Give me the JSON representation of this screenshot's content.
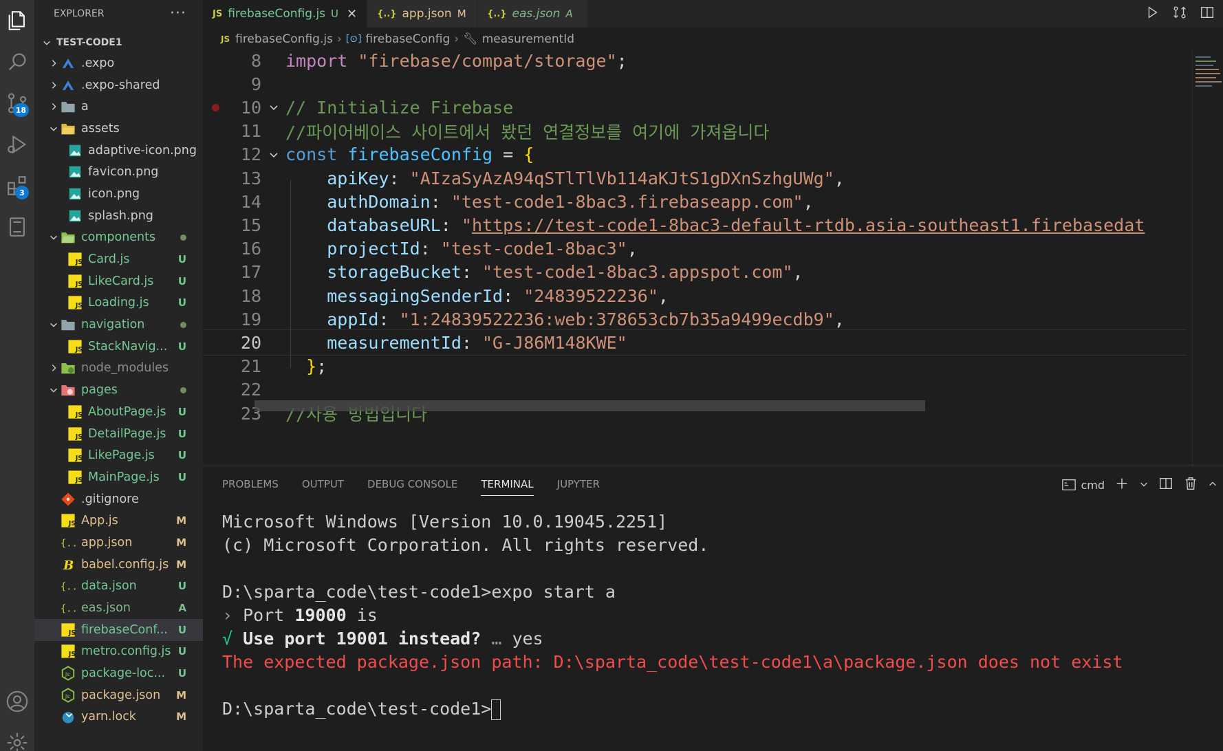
{
  "activity_bar": {
    "items": [
      {
        "name": "explorer"
      },
      {
        "name": "search"
      },
      {
        "name": "source-control",
        "badge": "18"
      },
      {
        "name": "run-debug"
      },
      {
        "name": "extensions",
        "badge": "3"
      },
      {
        "name": "remote-explorer"
      },
      {
        "name": "accounts"
      },
      {
        "name": "manage"
      }
    ]
  },
  "sidebar": {
    "title": "EXPLORER",
    "more": "···",
    "root": "TEST-CODE1",
    "tree": [
      {
        "label": ".expo",
        "depth": 0,
        "type": "folder",
        "expanded": false,
        "icon": "expo",
        "status": ""
      },
      {
        "label": ".expo-shared",
        "depth": 0,
        "type": "folder",
        "expanded": false,
        "icon": "expo",
        "status": ""
      },
      {
        "label": "a",
        "depth": 0,
        "type": "folder",
        "expanded": false,
        "icon": "folder",
        "status": ""
      },
      {
        "label": "assets",
        "depth": 0,
        "type": "folder",
        "expanded": true,
        "icon": "folder-yellow",
        "status": ""
      },
      {
        "label": "adaptive-icon.png",
        "depth": 1,
        "type": "file",
        "icon": "image",
        "status": ""
      },
      {
        "label": "favicon.png",
        "depth": 1,
        "type": "file",
        "icon": "image",
        "status": ""
      },
      {
        "label": "icon.png",
        "depth": 1,
        "type": "file",
        "icon": "image",
        "status": ""
      },
      {
        "label": "splash.png",
        "depth": 1,
        "type": "file",
        "icon": "image",
        "status": ""
      },
      {
        "label": "components",
        "depth": 0,
        "type": "folder",
        "expanded": true,
        "icon": "folder-green",
        "status": "dot",
        "color": "untracked"
      },
      {
        "label": "Card.js",
        "depth": 1,
        "type": "file",
        "icon": "js",
        "status": "U",
        "color": "untracked"
      },
      {
        "label": "LikeCard.js",
        "depth": 1,
        "type": "file",
        "icon": "js",
        "status": "U",
        "color": "untracked"
      },
      {
        "label": "Loading.js",
        "depth": 1,
        "type": "file",
        "icon": "js",
        "status": "U",
        "color": "untracked"
      },
      {
        "label": "navigation",
        "depth": 0,
        "type": "folder",
        "expanded": true,
        "icon": "folder",
        "status": "dot",
        "color": "untracked"
      },
      {
        "label": "StackNavig...",
        "depth": 1,
        "type": "file",
        "icon": "js",
        "status": "U",
        "color": "untracked"
      },
      {
        "label": "node_modules",
        "depth": 0,
        "type": "folder",
        "expanded": false,
        "icon": "folder-node",
        "status": "",
        "color": "ignored"
      },
      {
        "label": "pages",
        "depth": 0,
        "type": "folder",
        "expanded": true,
        "icon": "folder-red",
        "status": "dot",
        "color": "untracked"
      },
      {
        "label": "AboutPage.js",
        "depth": 1,
        "type": "file",
        "icon": "js",
        "status": "U",
        "color": "untracked"
      },
      {
        "label": "DetailPage.js",
        "depth": 1,
        "type": "file",
        "icon": "js",
        "status": "U",
        "color": "untracked"
      },
      {
        "label": "LikePage.js",
        "depth": 1,
        "type": "file",
        "icon": "js",
        "status": "U",
        "color": "untracked"
      },
      {
        "label": "MainPage.js",
        "depth": 1,
        "type": "file",
        "icon": "js",
        "status": "U",
        "color": "untracked"
      },
      {
        "label": ".gitignore",
        "depth": 0,
        "type": "file",
        "icon": "git",
        "status": ""
      },
      {
        "label": "App.js",
        "depth": 0,
        "type": "file",
        "icon": "js",
        "status": "M",
        "color": "mod"
      },
      {
        "label": "app.json",
        "depth": 0,
        "type": "file",
        "icon": "json",
        "status": "M",
        "color": "mod"
      },
      {
        "label": "babel.config.js",
        "depth": 0,
        "type": "file",
        "icon": "babel",
        "status": "M",
        "color": "mod"
      },
      {
        "label": "data.json",
        "depth": 0,
        "type": "file",
        "icon": "json",
        "status": "U",
        "color": "untracked"
      },
      {
        "label": "eas.json",
        "depth": 0,
        "type": "file",
        "icon": "json",
        "status": "A",
        "color": "added"
      },
      {
        "label": "firebaseConf...",
        "depth": 0,
        "type": "file",
        "icon": "js",
        "status": "U",
        "color": "untracked",
        "selected": true
      },
      {
        "label": "metro.config.js",
        "depth": 0,
        "type": "file",
        "icon": "js",
        "status": "U",
        "color": "untracked"
      },
      {
        "label": "package-loc...",
        "depth": 0,
        "type": "file",
        "icon": "node",
        "status": "U",
        "color": "untracked"
      },
      {
        "label": "package.json",
        "depth": 0,
        "type": "file",
        "icon": "node",
        "status": "M",
        "color": "mod"
      },
      {
        "label": "yarn.lock",
        "depth": 0,
        "type": "file",
        "icon": "yarn",
        "status": "M",
        "color": "mod"
      }
    ]
  },
  "tabs": [
    {
      "label": "firebaseConfig.js",
      "icon": "JS",
      "status": "U",
      "active": true,
      "close": "✕",
      "color": "untracked"
    },
    {
      "label": "app.json",
      "icon": "{..}",
      "status": "M",
      "active": false,
      "color": "mod"
    },
    {
      "label": "eas.json",
      "icon": "{..}",
      "status": "A",
      "active": false,
      "color": "added",
      "italic": true
    }
  ],
  "breadcrumb": {
    "file": "firebaseConfig.js",
    "symbol": "firebaseConfig",
    "property": "measurementId"
  },
  "code": {
    "current_line": 20,
    "breakpoint_line": 10,
    "lines": [
      {
        "n": "8",
        "tokens": [
          [
            "kw2",
            "import "
          ],
          [
            "str",
            "\"firebase/compat/storage\""
          ],
          [
            "punct",
            ";"
          ]
        ]
      },
      {
        "n": "9",
        "tokens": []
      },
      {
        "n": "10",
        "fold": true,
        "tokens": [
          [
            "cmt",
            "// Initialize Firebase"
          ]
        ]
      },
      {
        "n": "11",
        "tokens": [
          [
            "cmt",
            "//파이어베이스 사이트에서 봤던 연결정보를 여기에 가져옵니다"
          ]
        ]
      },
      {
        "n": "12",
        "fold": true,
        "tokens": [
          [
            "kw",
            "const "
          ],
          [
            "var",
            "firebaseConfig"
          ],
          [
            "punct",
            " = "
          ],
          [
            "brace",
            "{"
          ]
        ]
      },
      {
        "n": "13",
        "tokens": [
          [
            "punct",
            "    "
          ],
          [
            "prop",
            "apiKey"
          ],
          [
            "punct",
            ": "
          ],
          [
            "str",
            "\"AIzaSyAzA94qSTlTlVb114aKJtS1gDXnSzhgUWg\""
          ],
          [
            "punct",
            ","
          ]
        ]
      },
      {
        "n": "14",
        "tokens": [
          [
            "punct",
            "    "
          ],
          [
            "prop",
            "authDomain"
          ],
          [
            "punct",
            ": "
          ],
          [
            "str",
            "\"test-code1-8bac3.firebaseapp.com\""
          ],
          [
            "punct",
            ","
          ]
        ]
      },
      {
        "n": "15",
        "tokens": [
          [
            "punct",
            "    "
          ],
          [
            "prop",
            "databaseURL"
          ],
          [
            "punct",
            ": "
          ],
          [
            "str",
            "\""
          ],
          [
            "str url",
            "https://test-code1-8bac3-default-rtdb.asia-southeast1.firebasedat"
          ]
        ]
      },
      {
        "n": "16",
        "tokens": [
          [
            "punct",
            "    "
          ],
          [
            "prop",
            "projectId"
          ],
          [
            "punct",
            ": "
          ],
          [
            "str",
            "\"test-code1-8bac3\""
          ],
          [
            "punct",
            ","
          ]
        ]
      },
      {
        "n": "17",
        "tokens": [
          [
            "punct",
            "    "
          ],
          [
            "prop",
            "storageBucket"
          ],
          [
            "punct",
            ": "
          ],
          [
            "str",
            "\"test-code1-8bac3.appspot.com\""
          ],
          [
            "punct",
            ","
          ]
        ]
      },
      {
        "n": "18",
        "tokens": [
          [
            "punct",
            "    "
          ],
          [
            "prop",
            "messagingSenderId"
          ],
          [
            "punct",
            ": "
          ],
          [
            "str",
            "\"24839522236\""
          ],
          [
            "punct",
            ","
          ]
        ]
      },
      {
        "n": "19",
        "tokens": [
          [
            "punct",
            "    "
          ],
          [
            "prop",
            "appId"
          ],
          [
            "punct",
            ": "
          ],
          [
            "str",
            "\"1:24839522236:web:378653cb7b35a9499ecdb9\""
          ],
          [
            "punct",
            ","
          ]
        ]
      },
      {
        "n": "20",
        "tokens": [
          [
            "punct",
            "    "
          ],
          [
            "prop",
            "measurementId"
          ],
          [
            "punct",
            ": "
          ],
          [
            "str",
            "\"G-J86M148KWE\""
          ]
        ]
      },
      {
        "n": "21",
        "tokens": [
          [
            "punct",
            "  "
          ],
          [
            "brace",
            "}"
          ],
          [
            "punct",
            ";"
          ]
        ]
      },
      {
        "n": "22",
        "tokens": []
      },
      {
        "n": "23",
        "tokens": [
          [
            "cmt",
            "//사용 방법입니다"
          ]
        ]
      }
    ]
  },
  "panel": {
    "tabs": [
      "PROBLEMS",
      "OUTPUT",
      "DEBUG CONSOLE",
      "TERMINAL",
      "JUPYTER"
    ],
    "active_tab": "TERMINAL",
    "shell": "cmd"
  },
  "terminal": {
    "lines": [
      [
        [
          "",
          "Microsoft Windows [Version 10.0.19045.2251]"
        ]
      ],
      [
        [
          "",
          "(c) Microsoft Corporation. All rights reserved."
        ]
      ],
      [],
      [
        [
          "",
          "D:\\sparta_code\\test-code1>expo start a"
        ]
      ],
      [
        [
          "gray",
          "› "
        ],
        [
          "",
          "Port "
        ],
        [
          "bold",
          "19000"
        ],
        [
          "",
          " is"
        ]
      ],
      [
        [
          "green",
          "√ "
        ],
        [
          "bold",
          "Use port 19001 instead?"
        ],
        [
          "gray",
          " … "
        ],
        [
          "",
          "yes"
        ]
      ],
      [
        [
          "red",
          "The expected package.json path: D:\\sparta_code\\test-code1\\a\\package.json does not exist"
        ]
      ],
      [],
      [
        [
          "",
          "D:\\sparta_code\\test-code1>"
        ],
        [
          "cursor",
          ""
        ]
      ]
    ]
  }
}
